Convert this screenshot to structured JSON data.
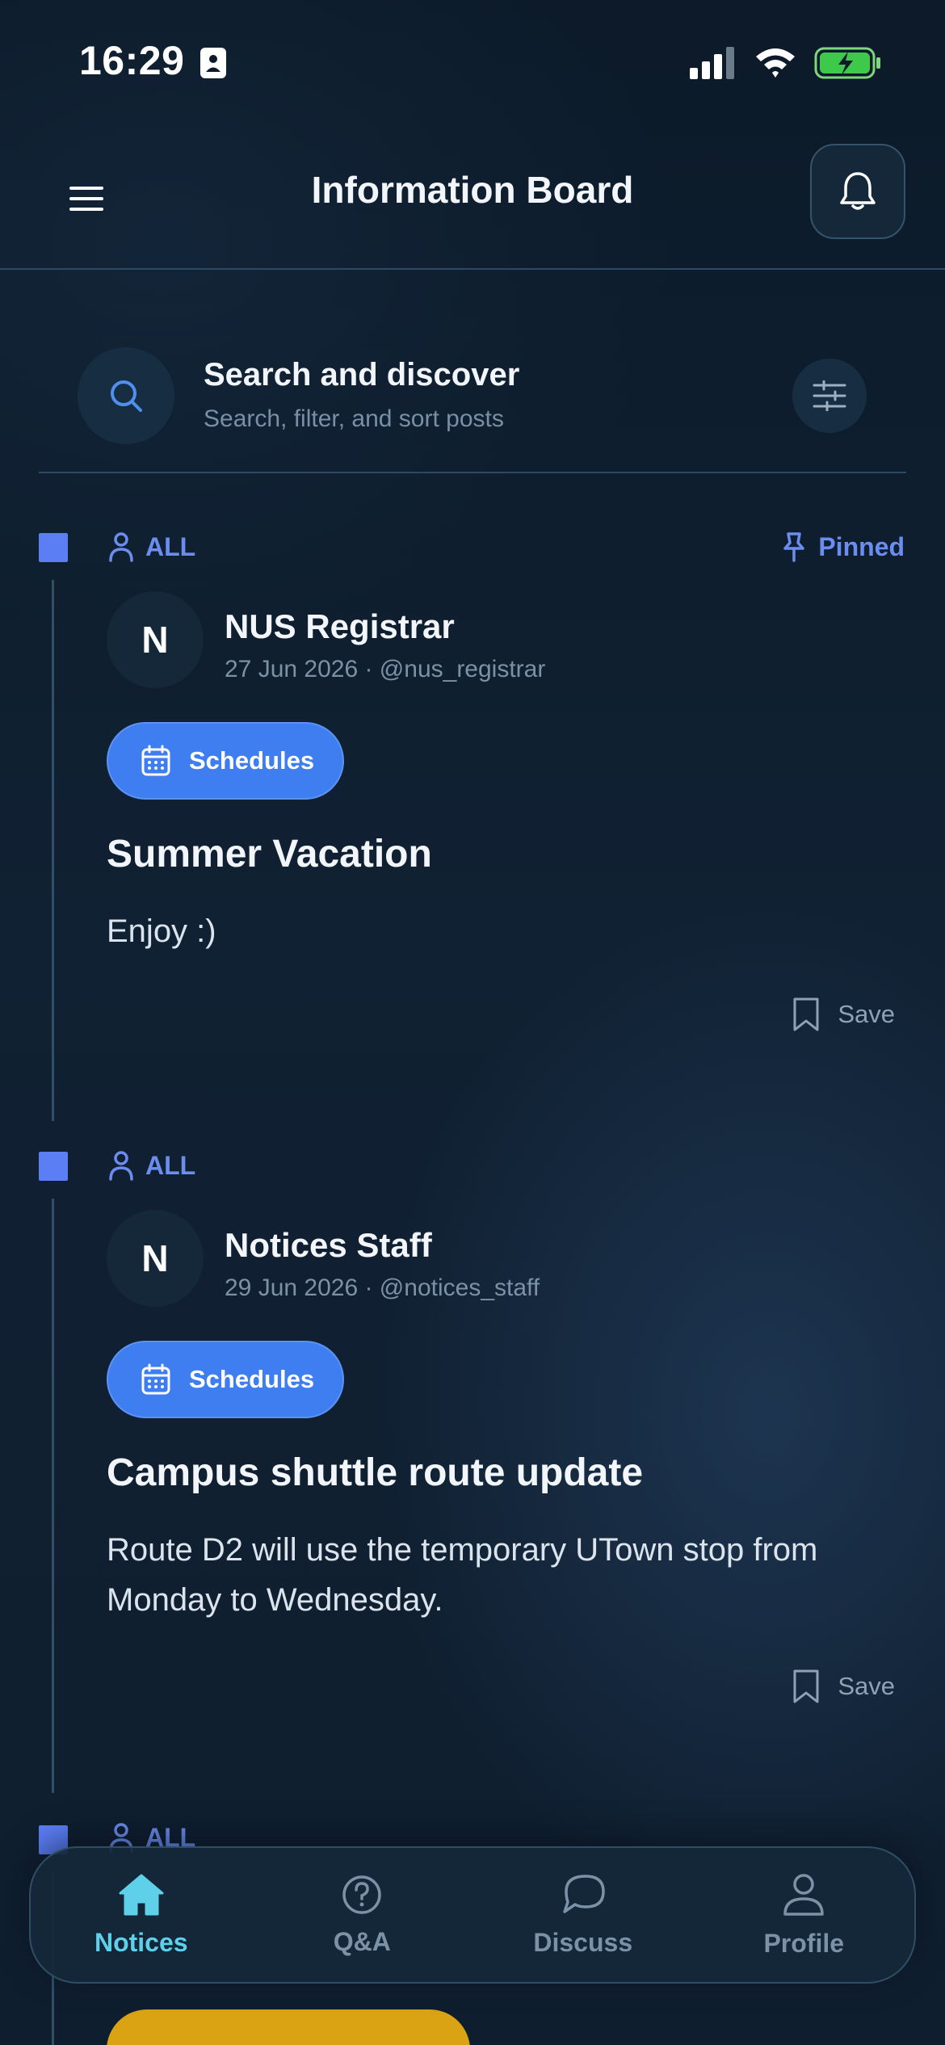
{
  "status_bar": {
    "time": "16:29"
  },
  "header": {
    "title": "Information Board"
  },
  "search": {
    "title": "Search and discover",
    "subtitle": "Search, filter, and sort posts"
  },
  "colors": {
    "accent_blue": "#5b7ef5",
    "tag_blue": "#3e7ef0",
    "active_nav": "#5fd0ea",
    "background": "#0e1b2a"
  },
  "posts": [
    {
      "audience": "ALL",
      "pinned_label": "Pinned",
      "avatar_initial": "N",
      "author": "NUS Registrar",
      "meta": "27 Jun 2026 · @nus_registrar",
      "tag": "Schedules",
      "title": "Summer Vacation",
      "body": "Enjoy :)",
      "save_label": "Save"
    },
    {
      "audience": "ALL",
      "avatar_initial": "N",
      "author": "Notices Staff",
      "meta": "29 Jun 2026 · @notices_staff",
      "tag": "Schedules",
      "title": "Campus shuttle route update",
      "body": "Route D2 will use the temporary UTown stop from Monday to Wednesday.",
      "save_label": "Save"
    },
    {
      "audience": "ALL"
    }
  ],
  "bottom_nav": {
    "items": [
      {
        "label": "Notices",
        "icon": "home-icon",
        "active": true
      },
      {
        "label": "Q&A",
        "icon": "question-icon",
        "active": false
      },
      {
        "label": "Discuss",
        "icon": "chat-bubble-icon",
        "active": false
      },
      {
        "label": "Profile",
        "icon": "person-icon",
        "active": false
      }
    ]
  }
}
